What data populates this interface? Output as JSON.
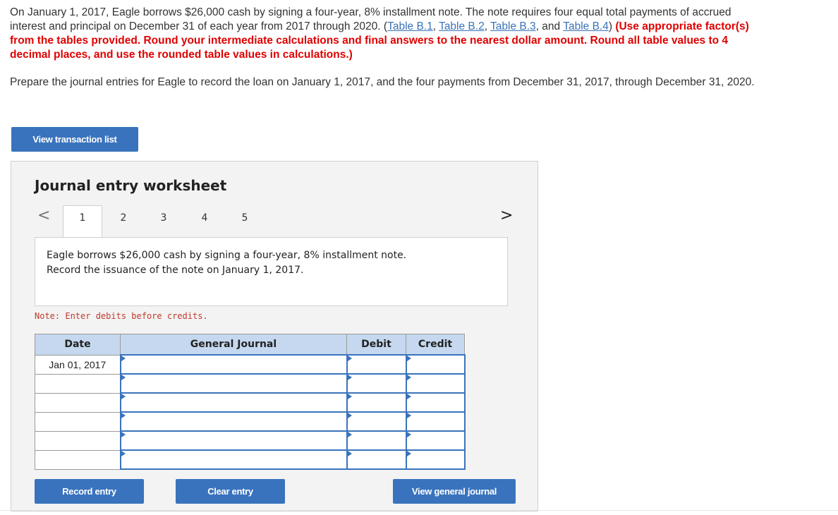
{
  "problem": {
    "text_1": "On January 1, 2017, Eagle borrows $26,000 cash by signing a four-year, 8% installment note. The note requires four equal total payments of accrued interest and principal on December 31 of each year from 2017 through 2020. (",
    "link_b1": "Table B.1",
    "sep_1": ", ",
    "link_b2": "Table B.2",
    "sep_2": ", ",
    "link_b3": "Table B.3",
    "sep_3": ", and ",
    "link_b4": "Table B.4",
    "close_paren": ") ",
    "red_text": "(Use appropriate factor(s) from the tables provided. Round your intermediate calculations and final answers to the nearest dollar amount. Round all table values to 4 decimal places, and use the rounded table values in calculations.)"
  },
  "instructions": "Prepare the journal entries for Eagle to record the loan on January 1, 2017, and the four payments from December 31, 2017, through December 31, 2020.",
  "view_transactions_label": "View transaction list",
  "worksheet": {
    "title": "Journal entry worksheet",
    "prev_arrow": "<",
    "next_arrow": ">",
    "tabs": [
      "1",
      "2",
      "3",
      "4",
      "5"
    ],
    "description_line1": "Eagle borrows $26,000 cash by signing a four-year, 8% installment note.",
    "description_line2": "Record the issuance of the note on January 1, 2017.",
    "note": "Note: Enter debits before credits.",
    "columns": {
      "date": "Date",
      "account": "General Journal",
      "debit": "Debit",
      "credit": "Credit"
    },
    "rows": [
      {
        "date": "Jan 01, 2017"
      },
      {
        "date": ""
      },
      {
        "date": ""
      },
      {
        "date": ""
      },
      {
        "date": ""
      },
      {
        "date": ""
      }
    ],
    "buttons": {
      "record": "Record entry",
      "clear": "Clear entry",
      "view_journal": "View general journal"
    }
  },
  "colors": {
    "button_blue": "#3a73bd",
    "header_blue": "#c5d8ef",
    "warning_red": "#e00000",
    "link_blue": "#3a73b8"
  }
}
